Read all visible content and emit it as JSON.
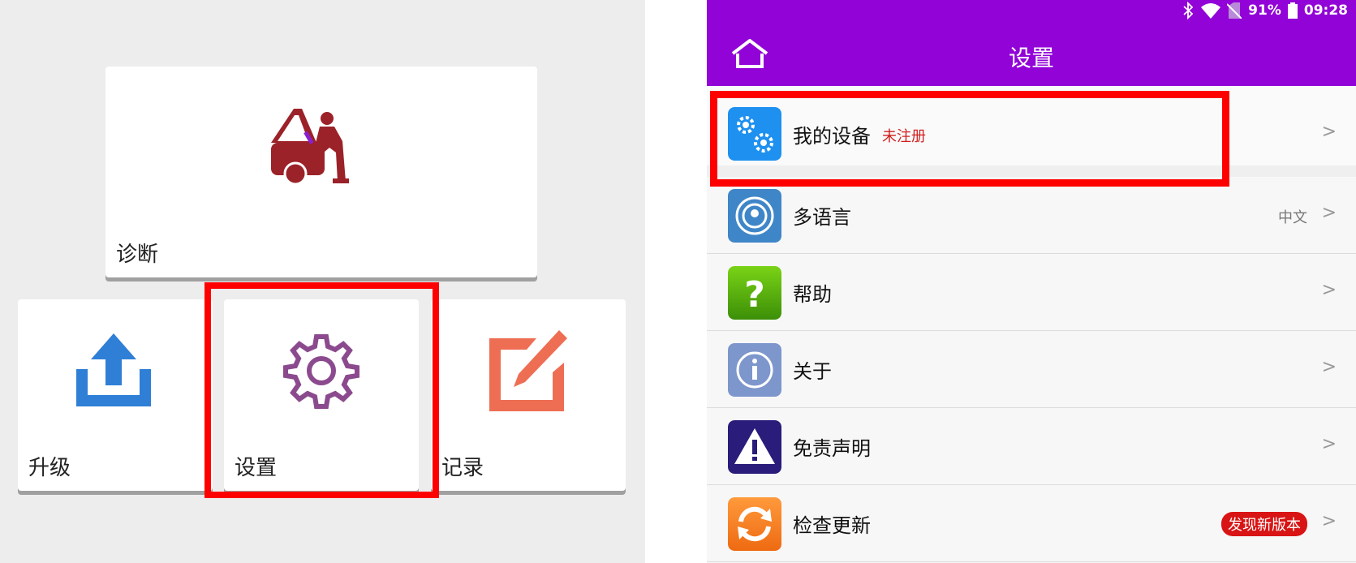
{
  "left": {
    "tiles": [
      {
        "label": "诊断",
        "icon": "car-repair-icon"
      },
      {
        "label": "升级",
        "icon": "upload-icon"
      },
      {
        "label": "设置",
        "icon": "gear-icon"
      },
      {
        "label": "记录",
        "icon": "edit-icon"
      }
    ]
  },
  "right": {
    "status": {
      "battery": "91%",
      "time": "09:28"
    },
    "title": "设置",
    "items": [
      {
        "label": "我的设备",
        "tag": "未注册",
        "icon": "device-settings-icon"
      },
      {
        "label": "多语言",
        "value": "中文",
        "icon": "globe-icon"
      },
      {
        "label": "帮助",
        "icon": "help-icon"
      },
      {
        "label": "关于",
        "icon": "info-icon"
      },
      {
        "label": "免责声明",
        "icon": "warning-icon"
      },
      {
        "label": "检查更新",
        "badge": "发现新版本",
        "icon": "refresh-icon"
      }
    ]
  },
  "colors": {
    "appbar": "#9203d7",
    "highlight": "#ff0000",
    "badge": "#d81414"
  }
}
